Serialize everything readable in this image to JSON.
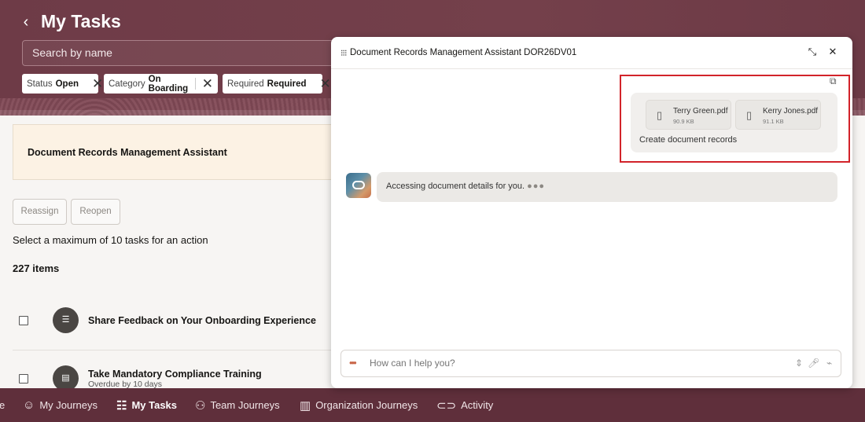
{
  "page": {
    "title": "My Tasks",
    "back_label": "‹",
    "search_placeholder": "Search by name"
  },
  "filters": [
    {
      "key": "Status",
      "value": "Open"
    },
    {
      "key": "Category",
      "value": "On Boarding"
    },
    {
      "key": "Required",
      "value": "Required"
    }
  ],
  "banner": {
    "text": "Document Records Management Assistant"
  },
  "actions": {
    "reassign": "Reassign",
    "reopen": "Reopen"
  },
  "info_text": "Select a maximum of 10 tasks for an action",
  "item_count": "227 items",
  "tasks": [
    {
      "title": "Share Feedback on Your Onboarding Experience",
      "subtitle": ""
    },
    {
      "title": "Take Mandatory Compliance Training",
      "subtitle": "Overdue by 10 days"
    }
  ],
  "nav": [
    {
      "label": "e",
      "icon": ""
    },
    {
      "label": "My Journeys",
      "icon": "person-icon"
    },
    {
      "label": "My Tasks",
      "icon": "checklist-icon",
      "active": true
    },
    {
      "label": "Team Journeys",
      "icon": "hierarchy-icon"
    },
    {
      "label": "Organization Journeys",
      "icon": "building-icon"
    },
    {
      "label": "Activity",
      "icon": "link-icon"
    }
  ],
  "assistant": {
    "title": "Document Records Management Assistant DOR26DV01",
    "user_message": {
      "files": [
        {
          "name": "Terry Green.pdf",
          "size": "90.9 KB"
        },
        {
          "name": "Kerry Jones.pdf",
          "size": "91.1 KB"
        }
      ],
      "text": "Create document records"
    },
    "bot_message": "Accessing document details for you.",
    "input_placeholder": "How can I help you?"
  },
  "colors": {
    "header": "#6e3b47",
    "nav": "#5f2f3b",
    "highlight": "#d2232a",
    "banner": "#fcf2e4"
  }
}
